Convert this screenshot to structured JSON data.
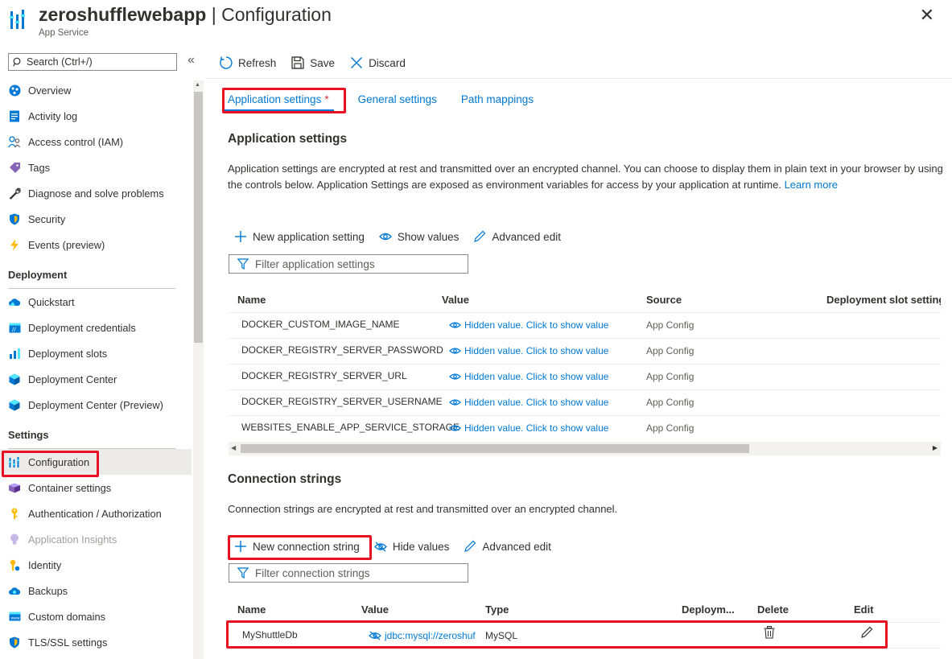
{
  "header": {
    "resource_name": "zeroshufflewebapp",
    "separator": " | ",
    "page_title": "Configuration",
    "subtitle": "App Service",
    "close_label": "✕"
  },
  "sidebar": {
    "search_placeholder": "Search (Ctrl+/)",
    "collapse_label": "«",
    "top_items": [
      {
        "label": "Overview",
        "icon": "overview-icon"
      },
      {
        "label": "Activity log",
        "icon": "activity-log-icon"
      },
      {
        "label": "Access control (IAM)",
        "icon": "access-control-icon"
      },
      {
        "label": "Tags",
        "icon": "tag-icon"
      },
      {
        "label": "Diagnose and solve problems",
        "icon": "wrench-icon"
      },
      {
        "label": "Security",
        "icon": "shield-icon"
      },
      {
        "label": "Events (preview)",
        "icon": "lightning-icon"
      }
    ],
    "deployment_header": "Deployment",
    "deployment_items": [
      {
        "label": "Quickstart",
        "icon": "cloud-icon"
      },
      {
        "label": "Deployment credentials",
        "icon": "credentials-icon"
      },
      {
        "label": "Deployment slots",
        "icon": "slots-icon"
      },
      {
        "label": "Deployment Center",
        "icon": "cube-icon"
      },
      {
        "label": "Deployment Center (Preview)",
        "icon": "cube-icon"
      }
    ],
    "settings_header": "Settings",
    "settings_items": [
      {
        "label": "Configuration",
        "icon": "configuration-icon",
        "selected": true
      },
      {
        "label": "Container settings",
        "icon": "container-icon"
      },
      {
        "label": "Authentication / Authorization",
        "icon": "key-icon"
      },
      {
        "label": "Application Insights",
        "icon": "lightbulb-icon",
        "disabled": true
      },
      {
        "label": "Identity",
        "icon": "identity-icon"
      },
      {
        "label": "Backups",
        "icon": "backup-icon"
      },
      {
        "label": "Custom domains",
        "icon": "domain-icon"
      },
      {
        "label": "TLS/SSL settings",
        "icon": "shield-icon"
      }
    ]
  },
  "toolbar": {
    "refresh_label": "Refresh",
    "save_label": "Save",
    "discard_label": "Discard"
  },
  "tabs": [
    {
      "label": "Application settings",
      "modified_marker": "*",
      "active": true
    },
    {
      "label": "General settings"
    },
    {
      "label": "Path mappings"
    }
  ],
  "app_settings": {
    "title": "Application settings",
    "description": "Application settings are encrypted at rest and transmitted over an encrypted channel. You can choose to display them in plain text in your browser by using the controls below. Application Settings are exposed as environment variables for access by your application at runtime.",
    "learn_more": "Learn more",
    "new_label": "New application setting",
    "show_values_label": "Show values",
    "advanced_edit_label": "Advanced edit",
    "filter_placeholder": "Filter application settings",
    "columns": [
      "Name",
      "Value",
      "Source",
      "Deployment slot setting"
    ],
    "rows": [
      {
        "name": "DOCKER_CUSTOM_IMAGE_NAME",
        "value": "Hidden value. Click to show value",
        "source": "App Config"
      },
      {
        "name": "DOCKER_REGISTRY_SERVER_PASSWORD",
        "value": "Hidden value. Click to show value",
        "source": "App Config"
      },
      {
        "name": "DOCKER_REGISTRY_SERVER_URL",
        "value": "Hidden value. Click to show value",
        "source": "App Config"
      },
      {
        "name": "DOCKER_REGISTRY_SERVER_USERNAME",
        "value": "Hidden value. Click to show value",
        "source": "App Config"
      },
      {
        "name": "WEBSITES_ENABLE_APP_SERVICE_STORAGE",
        "value": "Hidden value. Click to show value",
        "source": "App Config"
      }
    ]
  },
  "conn_strings": {
    "title": "Connection strings",
    "description": "Connection strings are encrypted at rest and transmitted over an encrypted channel.",
    "new_label": "New connection string",
    "hide_values_label": "Hide values",
    "advanced_edit_label": "Advanced edit",
    "filter_placeholder": "Filter connection strings",
    "columns": [
      "Name",
      "Value",
      "Type",
      "Deploym...",
      "Delete",
      "Edit"
    ],
    "rows": [
      {
        "name": "MyShuttleDb",
        "value": "jdbc:mysql://zeroshuf",
        "type": "MySQL"
      }
    ]
  },
  "colors": {
    "accent": "#0078d4",
    "highlight_box": "#e81123"
  }
}
